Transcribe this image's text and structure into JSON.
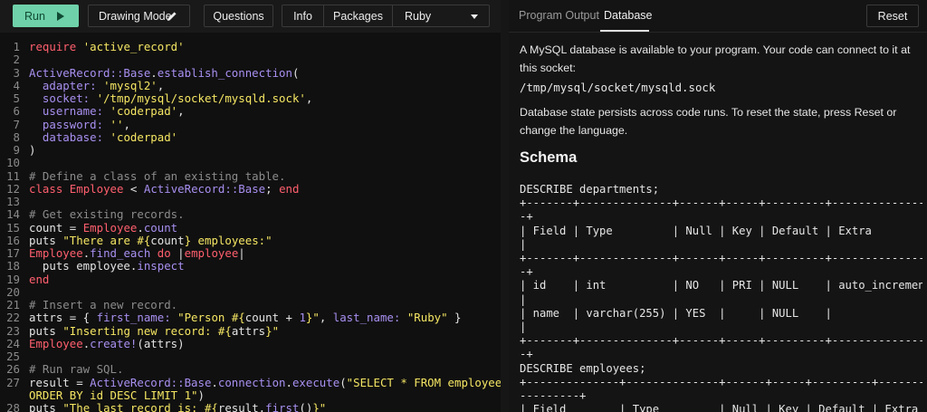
{
  "toolbar": {
    "run_label": "Run",
    "drawing_label": "Drawing Mode",
    "questions_label": "Questions",
    "info_label": "Info",
    "packages_label": "Packages",
    "language_value": "Ruby"
  },
  "editor": {
    "lines": [
      {
        "n": "1",
        "html": "<span class=\"kw\">require</span> <span class=\"str\">'active_record'</span>"
      },
      {
        "n": "2",
        "html": ""
      },
      {
        "n": "3",
        "html": "<span class=\"cls\">ActiveRecord::Base</span>.<span class=\"cls\">establish_connection</span>("
      },
      {
        "n": "4",
        "html": "  <span class=\"cls\">adapter:</span> <span class=\"str\">'mysql2'</span>,"
      },
      {
        "n": "5",
        "html": "  <span class=\"cls\">socket:</span> <span class=\"str\">'/tmp/mysql/socket/mysqld.sock'</span>,"
      },
      {
        "n": "6",
        "html": "  <span class=\"cls\">username:</span> <span class=\"str\">'coderpad'</span>,"
      },
      {
        "n": "7",
        "html": "  <span class=\"cls\">password:</span> <span class=\"str\">''</span>,"
      },
      {
        "n": "8",
        "html": "  <span class=\"cls\">database:</span> <span class=\"str\">'coderpad'</span>"
      },
      {
        "n": "9",
        "html": ")"
      },
      {
        "n": "10",
        "html": ""
      },
      {
        "n": "11",
        "html": "<span class=\"cmt\"># Define a class of an existing table.</span>"
      },
      {
        "n": "12",
        "html": "<span class=\"kw\">class</span> <span class=\"kw\">Employee</span> &lt; <span class=\"cls\">ActiveRecord::Base</span>; <span class=\"kw\">end</span>"
      },
      {
        "n": "13",
        "html": ""
      },
      {
        "n": "14",
        "html": "<span class=\"cmt\"># Get existing records.</span>"
      },
      {
        "n": "15",
        "html": "count = <span class=\"kw\">Employee</span>.<span class=\"cls\">count</span>"
      },
      {
        "n": "16",
        "html": "puts <span class=\"str\">\"There are #{</span>count<span class=\"str\">} employees:\"</span>"
      },
      {
        "n": "17",
        "html": "<span class=\"kw\">Employee</span>.<span class=\"cls\">find_each</span> <span class=\"kw\">do</span> |<span class=\"kw\">employee</span>|"
      },
      {
        "n": "18",
        "html": "  puts employee.<span class=\"cls\">inspect</span>"
      },
      {
        "n": "19",
        "html": "<span class=\"kw\">end</span>"
      },
      {
        "n": "20",
        "html": ""
      },
      {
        "n": "21",
        "html": "<span class=\"cmt\"># Insert a new record.</span>"
      },
      {
        "n": "22",
        "html": "attrs = { <span class=\"cls\">first_name:</span> <span class=\"str\">\"Person #{</span>count + <span class=\"cls\">1</span><span class=\"str\">}\"</span>, <span class=\"cls\">last_name:</span> <span class=\"str\">\"Ruby\"</span> }"
      },
      {
        "n": "23",
        "html": "puts <span class=\"str\">\"Inserting new record: #{</span>attrs<span class=\"str\">}\"</span>"
      },
      {
        "n": "24",
        "html": "<span class=\"kw\">Employee</span>.<span class=\"cls\">create!</span>(attrs)"
      },
      {
        "n": "25",
        "html": ""
      },
      {
        "n": "26",
        "html": "<span class=\"cmt\"># Run raw SQL.</span>"
      },
      {
        "n": "27",
        "html": "result = <span class=\"cls\">ActiveRecord::Base</span>.<span class=\"cls\">connection</span>.<span class=\"cls\">execute</span>(<span class=\"str\">\"SELECT * FROM employees</span>"
      },
      {
        "n": "",
        "html": "<span class=\"str\">ORDER BY id DESC LIMIT 1\"</span>)"
      },
      {
        "n": "28",
        "html": "puts <span class=\"str\">\"The last record is: #{</span>result.<span class=\"cls\">first</span>()<span class=\"str\">}\"</span>"
      }
    ]
  },
  "right_panel": {
    "tab_output": "Program Output",
    "tab_database": "Database",
    "reset_label": "Reset",
    "intro": "A MySQL database is available to your program. Your code can connect to it at this socket:",
    "socket_path": "/tmp/mysql/socket/mysqld.sock",
    "persist_text": "Database state persists across code runs. To reset the state, press Reset or change the language.",
    "schema_heading": "Schema",
    "schema_lines": [
      "DESCRIBE departments;",
      "+-------+--------------+------+-----+---------+----------------",
      "-+",
      "| Field | Type         | Null | Key | Default | Extra",
      "|",
      "+-------+--------------+------+-----+---------+----------------",
      "-+",
      "| id    | int          | NO   | PRI | NULL    | auto_increment",
      "|",
      "| name  | varchar(255) | YES  |     | NULL    |",
      "|",
      "+-------+--------------+------+-----+---------+----------------",
      "-+",
      "DESCRIBE employees;",
      "+--------------+--------------+------+-----+---------+-------",
      "---------+",
      "| Field        | Type         | Null | Key | Default | Extra",
      "|"
    ]
  }
}
